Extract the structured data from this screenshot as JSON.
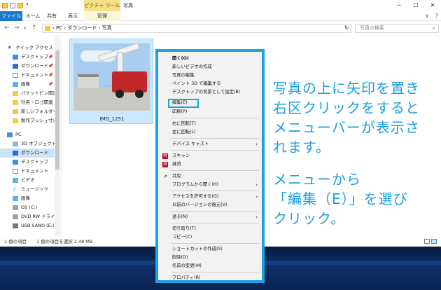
{
  "titlebar": {
    "context_tab": "ピクチャ ツール",
    "title": "写真",
    "minimize": "─",
    "maximize": "☐",
    "close": "✕",
    "qat_down": "▾"
  },
  "ribbon": {
    "tabs": [
      {
        "label": "ファイル"
      },
      {
        "label": "ホーム"
      },
      {
        "label": "共有"
      },
      {
        "label": "表示"
      },
      {
        "label": "管理"
      }
    ],
    "help": "?",
    "collapse": "∨"
  },
  "address": {
    "back": "←",
    "forward": "→",
    "recent": "∨",
    "up": "↑",
    "path": "› PC › ダウンロード › 写真",
    "dropdown": "∨",
    "refresh": "↻",
    "search_placeholder": "写真の検索",
    "search_icon": "⌕"
  },
  "navpane": {
    "items": [
      {
        "label": "クイック アクセス",
        "icon": "star-icon",
        "pinned": false
      },
      {
        "label": "デスクトップ",
        "icon": "desktop-icon",
        "pinned": true
      },
      {
        "label": "ダウンロード",
        "icon": "download-icon",
        "pinned": true
      },
      {
        "label": "ドキュメント",
        "icon": "document-icon",
        "pinned": true
      },
      {
        "label": "画像",
        "icon": "pictures-icon",
        "pinned": true
      },
      {
        "label": "パケットビン関連資",
        "icon": "folder-icon",
        "pinned": false
      },
      {
        "label": "社名・ロゴ関連",
        "icon": "folder-icon",
        "pinned": false
      },
      {
        "label": "新しいフォルダー",
        "icon": "folder-icon",
        "pinned": false
      },
      {
        "label": "製作プッシュ寸法",
        "icon": "folder-icon",
        "pinned": false
      },
      {
        "label": "PC",
        "icon": "pc-icon",
        "pinned": false
      },
      {
        "label": "3D オブジェクト",
        "icon": "3d-objects-icon",
        "pinned": false
      },
      {
        "label": "ダウンロード",
        "icon": "download-icon",
        "pinned": false
      },
      {
        "label": "デスクトップ",
        "icon": "desktop-icon",
        "pinned": false
      },
      {
        "label": "ドキュメント",
        "icon": "document-icon",
        "pinned": false
      },
      {
        "label": "ビデオ",
        "icon": "video-icon",
        "pinned": false
      },
      {
        "label": "ミュージック",
        "icon": "music-icon",
        "pinned": false
      },
      {
        "label": "画像",
        "icon": "pictures-icon",
        "pinned": false
      },
      {
        "label": "OS (C:)",
        "icon": "drive-icon",
        "pinned": false
      },
      {
        "label": "DVD RW ドライブ (",
        "icon": "dvd-drive-icon",
        "pinned": false
      },
      {
        "label": "USB SANO (E:)",
        "icon": "usb-drive-icon",
        "pinned": false
      }
    ],
    "pin_glyph": "📌",
    "star_glyph": "★",
    "music_glyph": "♪"
  },
  "content": {
    "file_name": "IMG_1251"
  },
  "statusbar": {
    "count": "1 個の項目",
    "selection": "1 個の項目を選択  2.48 MB"
  },
  "context_menu": {
    "items": [
      {
        "label": "開く(O)"
      },
      {
        "label": "新しいビデオの作成"
      },
      {
        "label": "写真の編集"
      },
      {
        "label": "ペイント 3D で編集する"
      },
      {
        "label": "デスクトップの背景として設定(B)"
      },
      {
        "label": "編集(E)"
      },
      {
        "label": "印刷(P)"
      },
      {
        "label": "右に回転(T)"
      },
      {
        "label": "左に回転(L)"
      },
      {
        "label": "デバイス キャスト"
      },
      {
        "label": "スキャン"
      },
      {
        "label": "抹消"
      },
      {
        "label": "共有"
      },
      {
        "label": "プログラムから開く(H)"
      },
      {
        "label": "アクセスを許可する(G)"
      },
      {
        "label": "以前のバージョンの復元(V)"
      },
      {
        "label": "送る(N)"
      },
      {
        "label": "切り取り(T)"
      },
      {
        "label": "コピー(C)"
      },
      {
        "label": "ショートカットの作成(S)"
      },
      {
        "label": "削除(D)"
      },
      {
        "label": "名前の変更(M)"
      },
      {
        "label": "プロパティ(R)"
      }
    ],
    "submenu_arrow": "›",
    "mcafee_glyph": "M",
    "share_glyph": "⇗"
  },
  "annotation": {
    "lines": [
      "写真の上に矢印を置き",
      "右区クリックをすると",
      "メニューバーが表示さ",
      "れます。",
      "",
      "メニューから",
      "「編集（E）」を選び",
      "クリック。"
    ],
    "color": "#1f9fde"
  },
  "colors": {
    "accent": "#1979ca",
    "highlight": "#1fa3e0",
    "selection": "#cce8ff"
  }
}
